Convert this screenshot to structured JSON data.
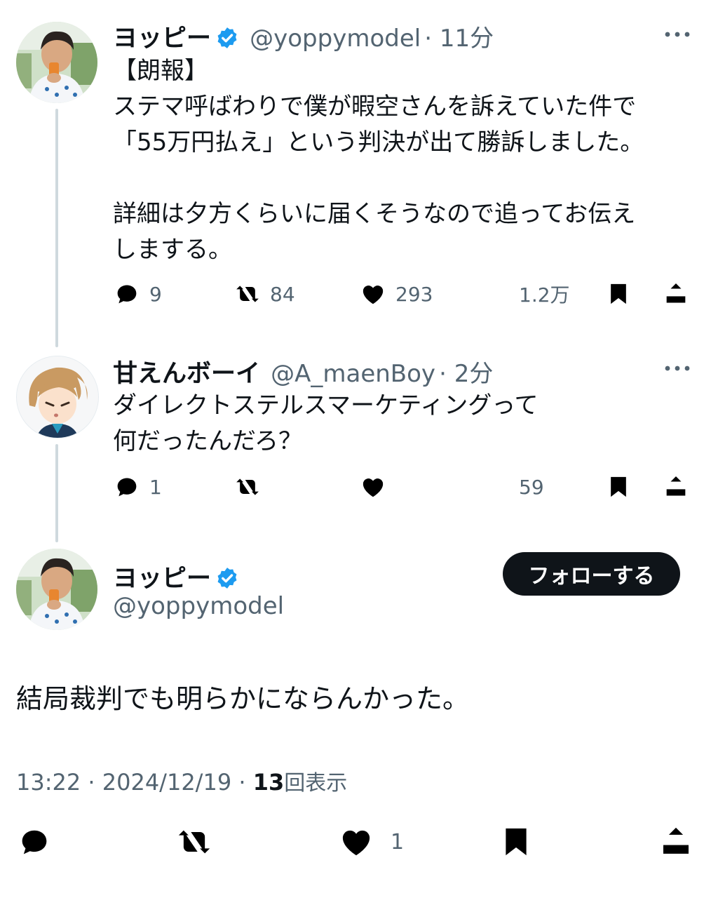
{
  "tweet1": {
    "name": "ヨッピー",
    "handle": "@yoppymodel",
    "time": "· 11分",
    "text": "【朗報】\nステマ呼ばわりで僕が暇空さんを訴えていた件で\n「55万円払え」という判決が出て勝訴しました。\n\n詳細は夕方くらいに届くそうなので追ってお伝え\nしまする。",
    "replies": "9",
    "retweets": "84",
    "likes": "293",
    "views": "1.2万"
  },
  "tweet2": {
    "name": "甘えんボーイ",
    "handle": "@A_maenBoy",
    "time": "· 2分",
    "text": "ダイレクトステルスマーケティングって\n何だったんだろ？",
    "replies": "1",
    "views": "59"
  },
  "tweet3": {
    "name": "ヨッピー",
    "handle": "@yoppymodel",
    "follow_label": "フォローする",
    "text": "結局裁判でも明らかにならんかった。",
    "time": "13:22",
    "date": "· 2024/12/19 ·",
    "views_count": "13",
    "views_label": "回表示",
    "likes": "1"
  },
  "icons": {
    "verified": "verified-badge-icon",
    "more": "more-icon",
    "reply": "reply-icon",
    "retweet": "retweet-icon",
    "like": "like-icon",
    "views": "views-icon",
    "bookmark": "bookmark-icon",
    "share": "share-icon"
  },
  "colors": {
    "verified": "#1d9bf0",
    "text": "#0f1419",
    "secondary": "#536471",
    "thread_line": "#cfd9de",
    "follow_bg": "#0f1419"
  }
}
